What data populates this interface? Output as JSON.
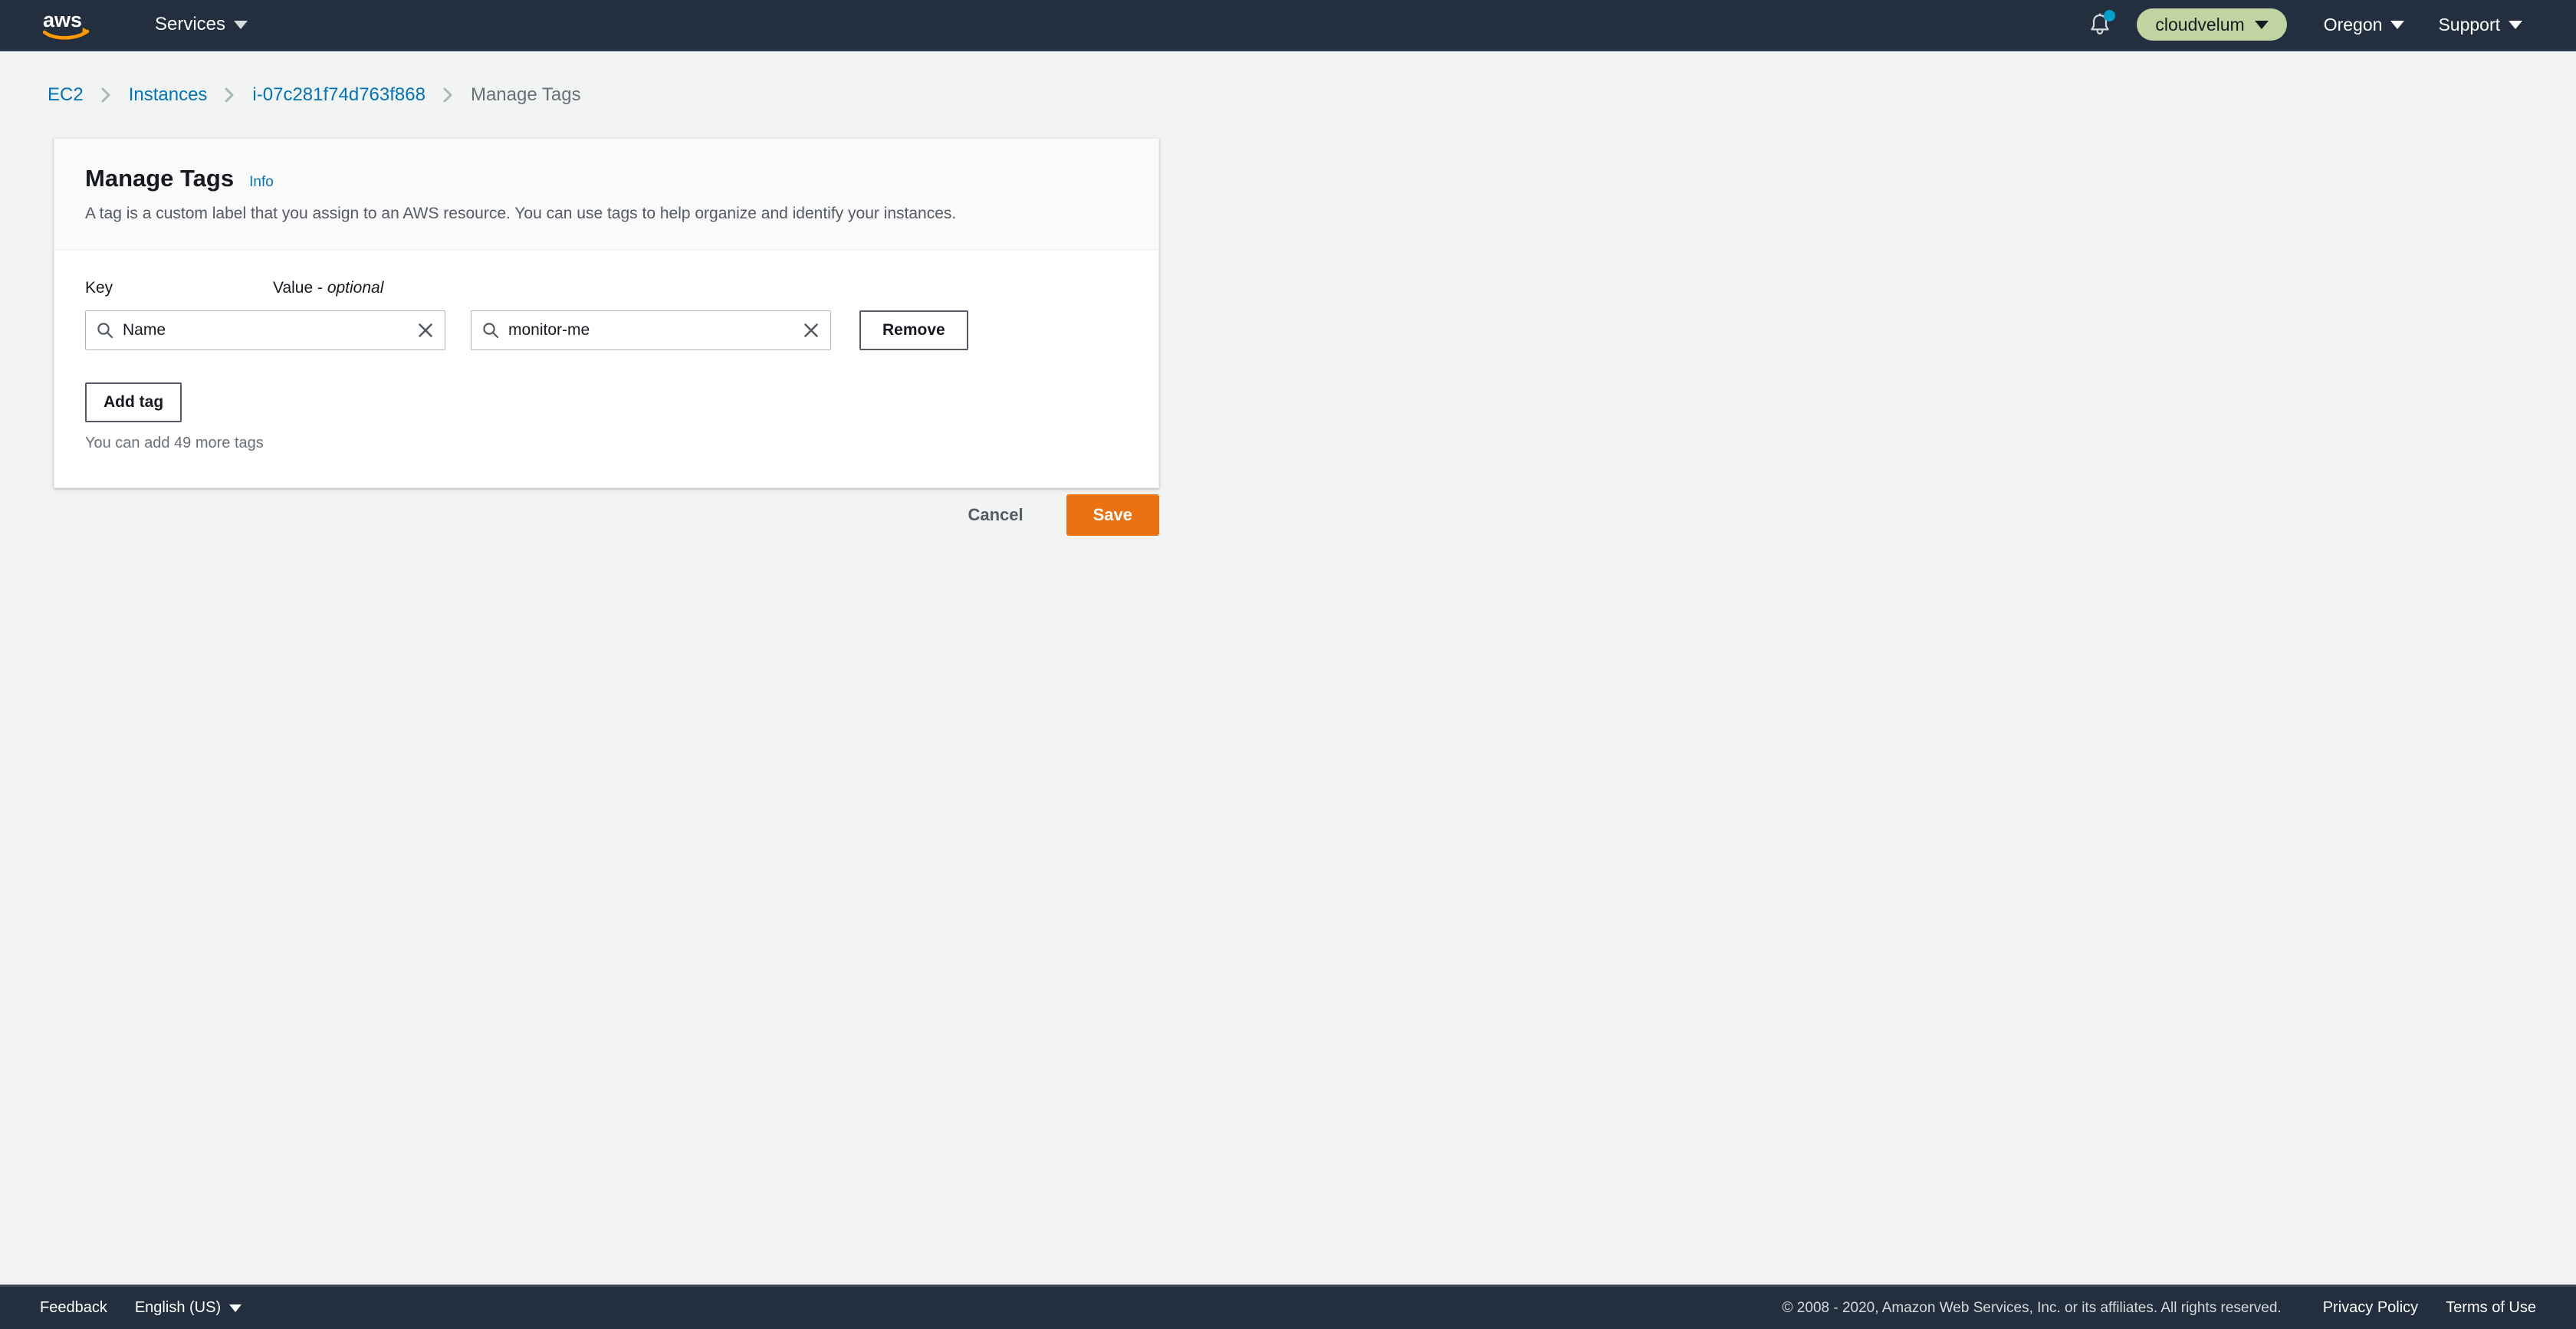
{
  "topnav": {
    "logo_icon": "aws-logo",
    "services_label": "Services",
    "notifications_icon": "bell-icon",
    "notification_dot_color": "#00a1c9",
    "account_label": "cloudvelum",
    "account_pill_color": "#bfd4a0",
    "region_label": "Oregon",
    "support_label": "Support",
    "background_color": "#232f3e"
  },
  "breadcrumb": {
    "items": [
      {
        "label": "EC2",
        "is_link": true
      },
      {
        "label": "Instances",
        "is_link": true
      },
      {
        "label": "i-07c281f74d763f868",
        "is_link": true
      },
      {
        "label": "Manage Tags",
        "is_link": false
      }
    ],
    "separator_icon": "chevron-right-icon",
    "link_color": "#0073bb"
  },
  "card": {
    "title": "Manage Tags",
    "info_label": "Info",
    "description": "A tag is a custom label that you assign to an AWS resource. You can use tags to help organize and identify your instances.",
    "labels": {
      "key": "Key",
      "value_prefix": "Value - ",
      "value_optional": "optional"
    },
    "tags": [
      {
        "key_value": "Name",
        "key_placeholder": "",
        "key_search_icon": "search-icon",
        "key_clear_icon": "close-icon",
        "value_value": "monitor-me",
        "value_placeholder": "",
        "value_search_icon": "search-icon",
        "value_clear_icon": "close-icon",
        "remove_label": "Remove"
      }
    ],
    "add_tag_label": "Add tag",
    "hint": "You can add 49 more tags"
  },
  "actions": {
    "cancel_label": "Cancel",
    "save_label": "Save",
    "save_color": "#ec7211"
  },
  "footer": {
    "feedback_label": "Feedback",
    "language_label": "English (US)",
    "copyright": "© 2008 - 2020, Amazon Web Services, Inc. or its affiliates. All rights reserved.",
    "privacy_label": "Privacy Policy",
    "terms_label": "Terms of Use"
  }
}
